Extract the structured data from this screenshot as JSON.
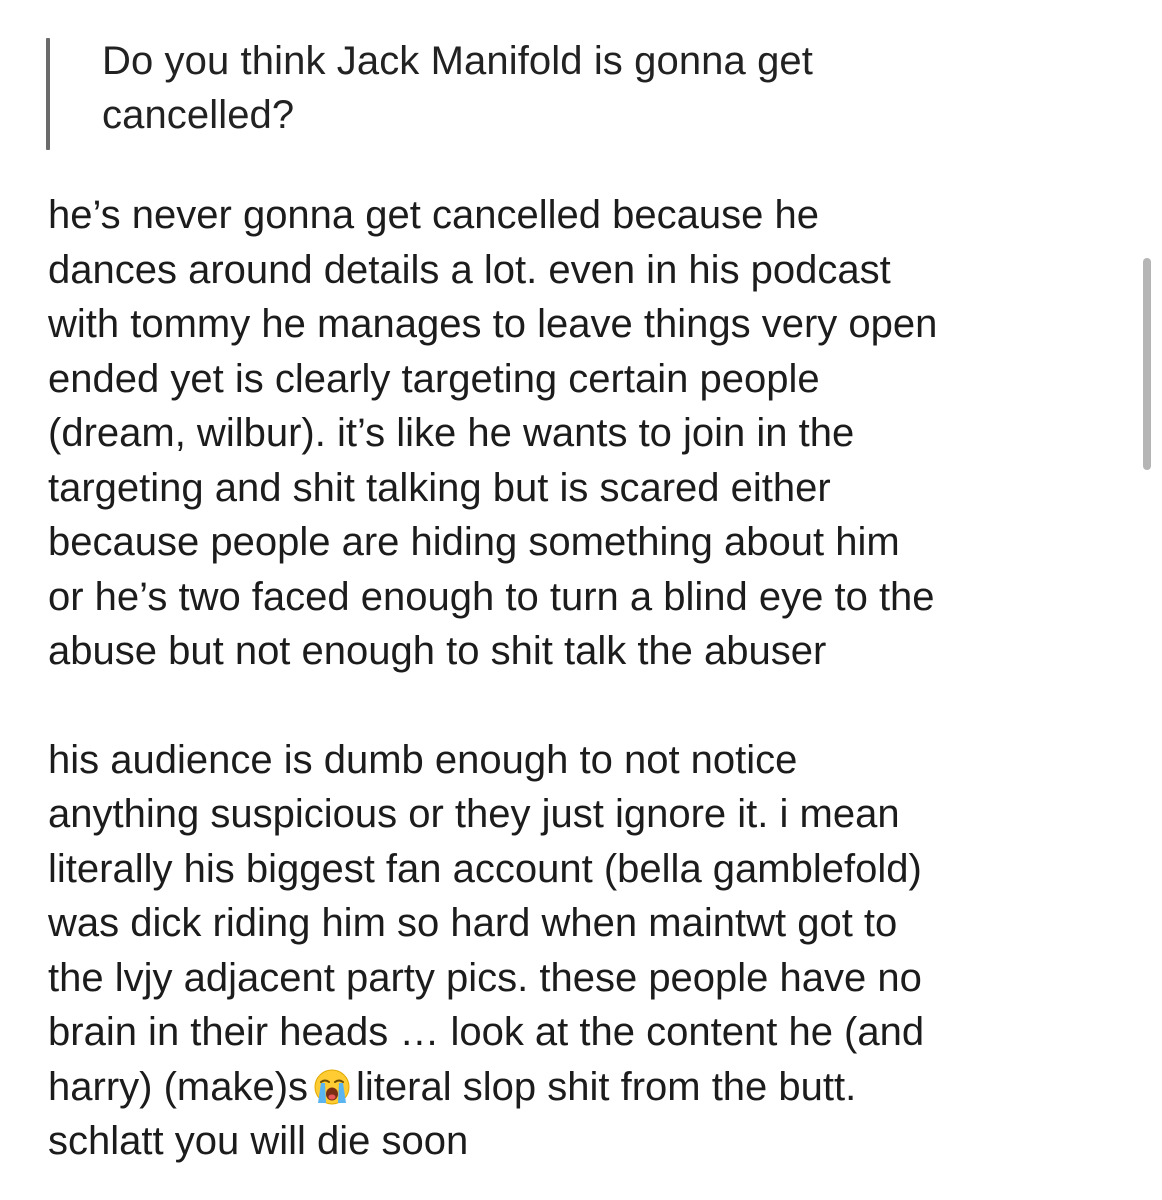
{
  "question": {
    "text": "Do you think Jack Manifold is gonna get\ncancelled?"
  },
  "answer": {
    "paragraph_1": "he’s never gonna get cancelled because he\ndances around details a lot. even in his podcast\nwith tommy he manages to leave things very open\nended yet is clearly targeting certain people\n(dream, wilbur). it’s like he wants to join in the\ntargeting and shit talking but is scared either\nbecause people are hiding something about him\nor he’s two faced enough to turn a blind eye to the\nabuse but not enough to shit talk the abuser",
    "paragraph_2_before_emoji": "his audience is dumb enough to not notice\nanything suspicious or they just ignore it. i mean\nliterally his biggest fan account (bella gamblefold)\nwas dick riding him so hard when maintwt got to\nthe lvjy adjacent party pics. these people have no\nbrain in their heads … look at the content he (and\nharry) (make)s",
    "emoji_icon": "loudly-crying-face-icon",
    "paragraph_2_after_emoji": "literal slop shit from the butt.\nschlatt you will die soon"
  }
}
